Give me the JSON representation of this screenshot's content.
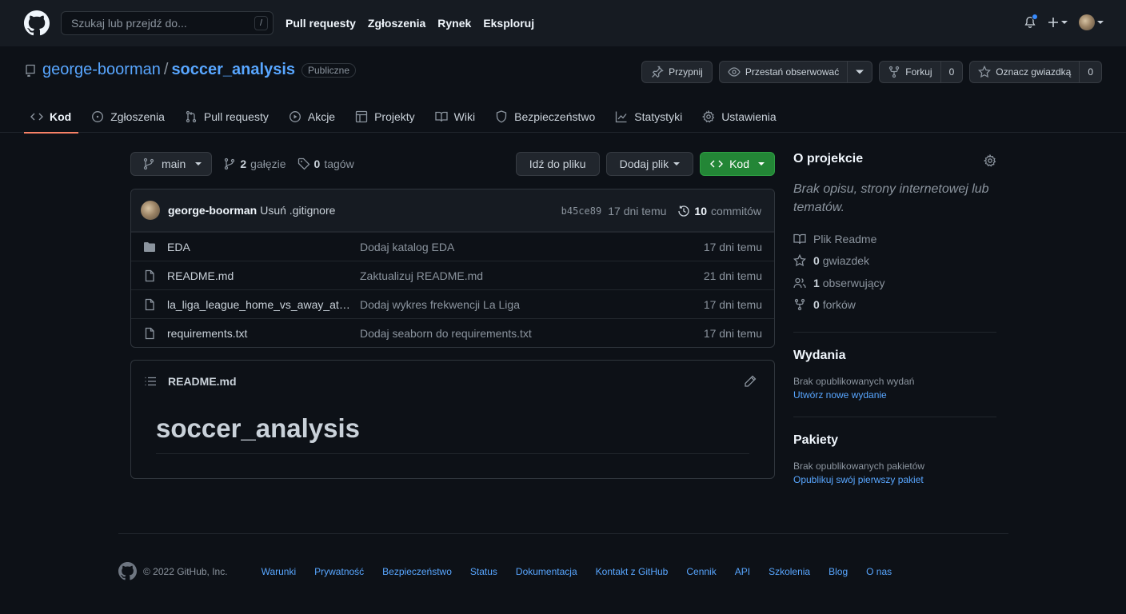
{
  "header": {
    "search_placeholder": "Szukaj lub przejdź do...",
    "search_key": "/",
    "nav": [
      "Pull requesty",
      "Zgłoszenia",
      "Rynek",
      "Eksploruj"
    ]
  },
  "repo": {
    "owner": "george-boorman",
    "separator": "/",
    "name": "soccer_analysis",
    "visibility": "Publiczne",
    "actions": {
      "pin": "Przypnij",
      "unwatch": "Przestań obserwować",
      "fork": "Forkuj",
      "fork_count": "0",
      "star": "Oznacz gwiazdką",
      "star_count": "0"
    },
    "tabs": [
      "Kod",
      "Zgłoszenia",
      "Pull requesty",
      "Akcje",
      "Projekty",
      "Wiki",
      "Bezpieczeństwo",
      "Statystyki",
      "Ustawienia"
    ]
  },
  "branch_bar": {
    "branch": "main",
    "branches_count": "2",
    "branches_label": "gałęzie",
    "tags_count": "0",
    "tags_label": "tagów",
    "go_to_file": "Idź do pliku",
    "add_file": "Dodaj plik",
    "code": "Kod"
  },
  "last_commit": {
    "author": "george-boorman",
    "message": "Usuń .gitignore",
    "sha": "b45ce89",
    "age": "17 dni temu",
    "commits_count": "10",
    "commits_label": "commitów"
  },
  "files": [
    {
      "type": "folder",
      "name": "EDA",
      "message": "Dodaj katalog EDA",
      "age": "17 dni temu"
    },
    {
      "type": "file",
      "name": "README.md",
      "message": "Zaktualizuj README.md",
      "age": "21 dni temu"
    },
    {
      "type": "file",
      "name": "la_liga_league_home_vs_away_attendance",
      "message": "Dodaj wykres frekwencji La Liga",
      "age": "17 dni temu"
    },
    {
      "type": "file",
      "name": "requirements.txt",
      "message": "Dodaj seaborn do requirements.txt",
      "age": "17 dni temu"
    }
  ],
  "readme": {
    "filename": "README.md",
    "heading": "soccer_analysis"
  },
  "sidebar": {
    "about_title": "O projekcie",
    "about_desc": "Brak opisu, strony internetowej lub tematów.",
    "readme_label": "Plik Readme",
    "stars_count": "0",
    "stars_label": "gwiazdek",
    "watchers_count": "1",
    "watchers_label": "obserwujący",
    "forks_count": "0",
    "forks_label": "forków",
    "releases_title": "Wydania",
    "releases_text": "Brak opublikowanych wydań",
    "releases_link": "Utwórz nowe wydanie",
    "packages_title": "Pakiety",
    "packages_text": "Brak opublikowanych pakietów",
    "packages_link": "Opublikuj swój pierwszy pakiet"
  },
  "footer": {
    "copyright": "© 2022 GitHub, Inc.",
    "links": [
      "Warunki",
      "Prywatność",
      "Bezpieczeństwo",
      "Status",
      "Dokumentacja",
      "Kontakt z GitHub",
      "Cennik",
      "API",
      "Szkolenia",
      "Blog",
      "O nas"
    ]
  },
  "colors": {
    "background": "#0d1117",
    "header_bg": "#161b22",
    "link": "#58a6ff",
    "green_button": "#238636",
    "active_tab_underline": "#f78166"
  }
}
